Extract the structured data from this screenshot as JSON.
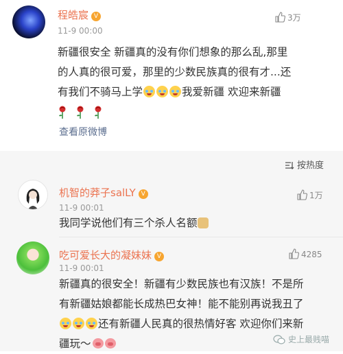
{
  "post": {
    "username": "程皓宸",
    "timestamp": "11-9 00:00",
    "likes": "3万",
    "text_line1": "新疆很安全 新疆真的没有你们想象的那么乱,那里",
    "text_line2": "的人真的很可爱，那里的少数民族真的很有才...还",
    "text_line3_start": "有我们不骑马上学",
    "text_line3_end": "我爱新疆 欢迎来新疆",
    "view_original": "查看原微博"
  },
  "sort": {
    "label": "按热度"
  },
  "comments": [
    {
      "username": "机智的莽子salLY",
      "timestamp": "11-9 00:01",
      "likes": "1万",
      "text": "我同学说他们有三个杀人名额"
    },
    {
      "username": "吃可爱长大的凝妹妹",
      "timestamp": "11-9 00:01",
      "likes": "4285",
      "text_line1": "新疆真的很安全！新疆有少数民族也有汉族！不是所",
      "text_line2": "有新疆姑娘都能长成热巴女神！能不能别再说我丑了",
      "text_line3": "还有新疆人民真的很热情好客 欢迎你们来新",
      "text_line4": "疆玩～"
    }
  ],
  "watermark": {
    "text": "史上最贱喵"
  },
  "colors": {
    "username": "#eb7350",
    "link": "#5d6f90",
    "band": "#f6f6f6"
  },
  "icons": [
    "thumbs-up-icon",
    "sort-icon",
    "rose-emoji",
    "laugh-cry-emoji",
    "doge-emoji",
    "pig-emoji",
    "vip-badge-icon",
    "wechat-icon"
  ]
}
